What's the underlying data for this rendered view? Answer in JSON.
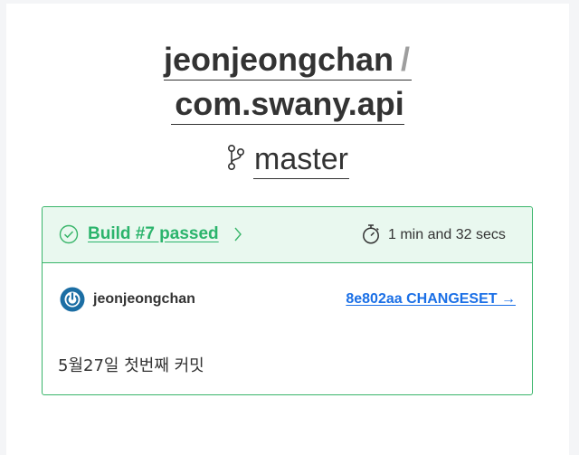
{
  "repo": {
    "owner": "jeonjeongchan",
    "separator": "/",
    "name": "com.swany.api"
  },
  "branch": {
    "name": "master",
    "icon": "git-branch-icon"
  },
  "build": {
    "status_icon": "check-circle-icon",
    "label": "Build #7 passed",
    "duration_icon": "stopwatch-icon",
    "duration": "1 min and 32 secs",
    "status_color": "#39b56a",
    "header_bg": "#e9f8ef"
  },
  "commit": {
    "author_icon": "avatar-icon",
    "author": "jeonjeongchan",
    "changeset": "8e802aa CHANGESET →",
    "message": "5월27일 첫번째 커밋",
    "link_color": "#1a6fe6"
  }
}
